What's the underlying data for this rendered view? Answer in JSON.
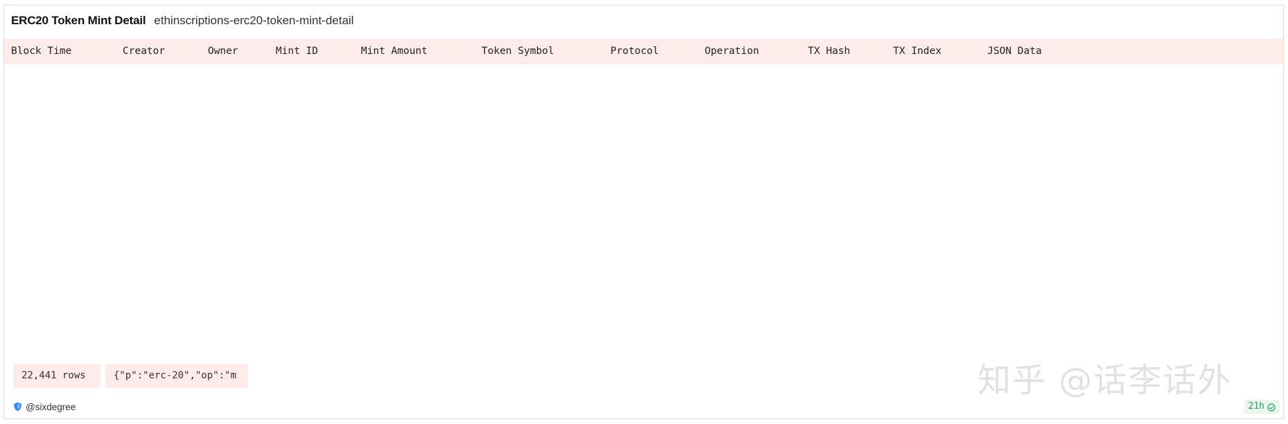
{
  "header": {
    "title": "ERC20 Token Mint Detail",
    "subtitle": "ethinscriptions-erc20-token-mint-detail"
  },
  "table": {
    "columns": [
      "Block Time",
      "Creator",
      "Owner",
      "Mint ID",
      "Mint Amount",
      "Token Symbol",
      "Protocol",
      "Operation",
      "TX Hash",
      "TX Index",
      "JSON Data"
    ]
  },
  "footer": {
    "rows_count": "22,441 rows",
    "json_preview": "{\"p\":\"erc-20\",\"op\":\"m",
    "owner": "@sixdegree",
    "freshness": "21h"
  },
  "watermark": "知乎 @话李话外",
  "colors": {
    "header_bg": "#fdecea",
    "badge_bg": "#e8f6ee",
    "badge_text": "#2e9e5b",
    "border": "#f0d8cf"
  },
  "icons": {
    "owner_icon": "shield-icon",
    "freshness_icon": "check-circle-icon"
  }
}
